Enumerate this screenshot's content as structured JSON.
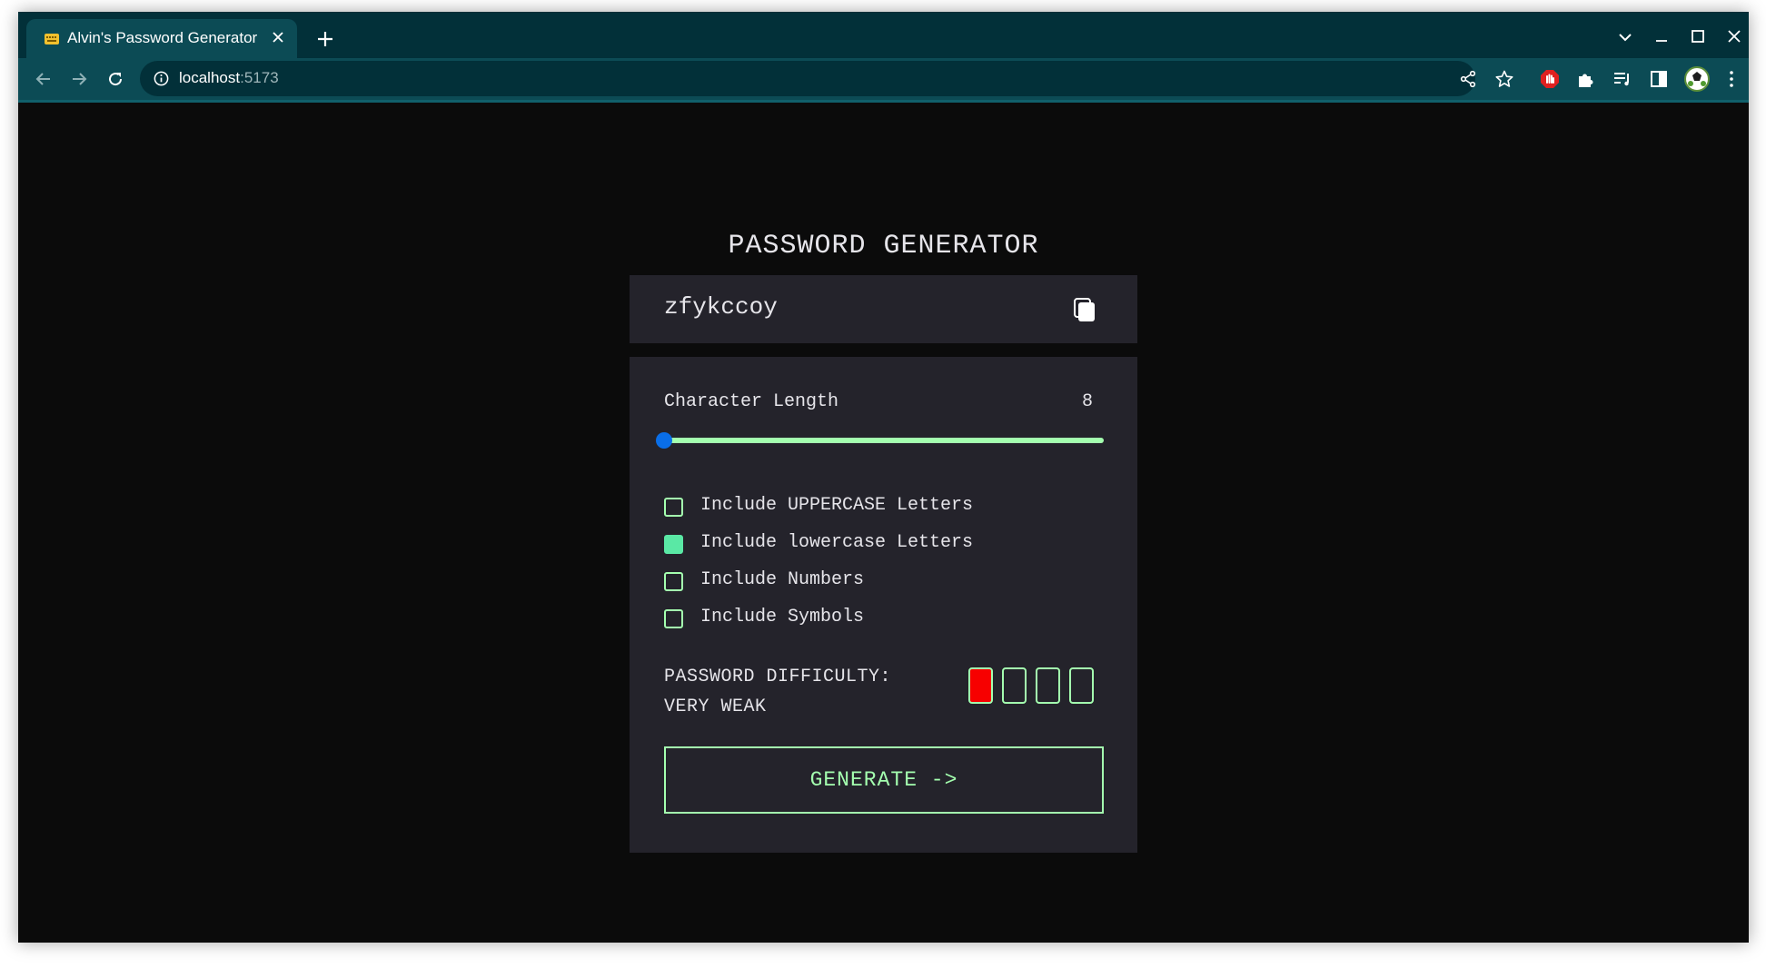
{
  "browser": {
    "tab_title": "Alvin's Password Generator",
    "url_host": "localhost",
    "url_port": ":5173"
  },
  "app": {
    "title": "PASSWORD GENERATOR",
    "password": "zfykccoy",
    "length_label": "Character Length",
    "length_value": "8",
    "length_fraction": 0.0,
    "options": [
      {
        "label": "Include UPPERCASE Letters",
        "checked": false
      },
      {
        "label": "Include lowercase Letters",
        "checked": true
      },
      {
        "label": "Include Numbers",
        "checked": false
      },
      {
        "label": "Include Symbols",
        "checked": false
      }
    ],
    "difficulty_label": "PASSWORD DIFFICULTY:",
    "difficulty_value": "VERY WEAK",
    "difficulty_level": 1,
    "difficulty_max": 4,
    "generate_label": "GENERATE ->"
  },
  "colors": {
    "accent": "#a4ffaf",
    "checked": "#5ae8a5",
    "strength_bar": "#f70000",
    "slider_thumb": "#0a6ee8",
    "panel": "#24232b",
    "background": "#0b0b0b",
    "chrome_frame": "#023039",
    "chrome_toolbar": "#0c4b55"
  },
  "icons": {
    "tab_favicon": "keyboard-favicon-icon",
    "tab_close": "close-icon",
    "new_tab": "plus-icon",
    "back": "arrow-left-icon",
    "forward": "arrow-right-icon",
    "reload": "reload-icon",
    "site_info": "info-icon",
    "share": "share-icon",
    "bookmark": "star-icon",
    "extension_adblock": "adblock-icon",
    "extensions": "puzzle-icon",
    "reading_list": "media-queue-icon",
    "side_panel": "side-panel-icon",
    "profile": "avatar-icon",
    "menu": "kebab-menu-icon",
    "copy": "copy-icon"
  }
}
